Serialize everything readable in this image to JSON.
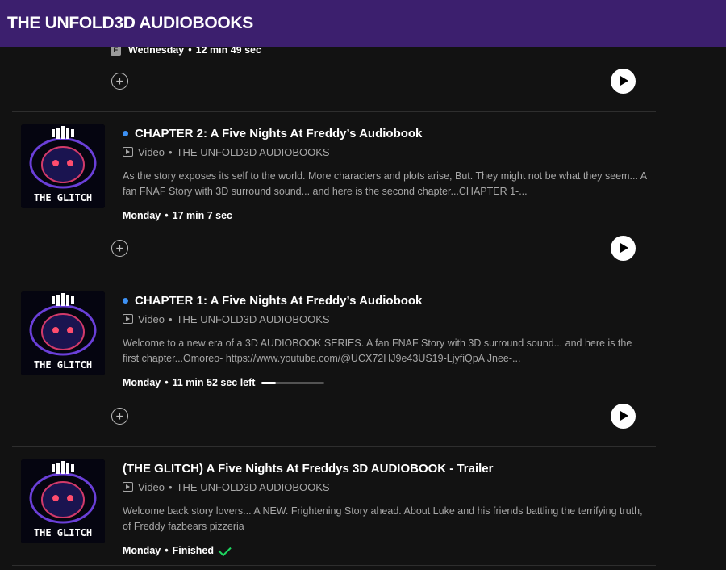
{
  "header": {
    "title": "THE UNFOLD3D AUDIOBOOKS"
  },
  "colors": {
    "header_bg": "#3c1f6e",
    "unplayed_dot": "#3d91f4",
    "finished_check": "#1ed760"
  },
  "partial_episode": {
    "explicit_badge": "E",
    "day": "Wednesday",
    "duration": "12 min 49 sec"
  },
  "episodes": [
    {
      "thumbnail_text": "THE GLITCH",
      "title": "CHAPTER 2: A Five Nights At Freddy’s Audiobook",
      "type": "Video",
      "show": "THE UNFOLD3D AUDIOBOOKS",
      "description": "As the story exposes its self to the world. More characters and plots arise, But. They might not be what they seem... A fan FNAF Story with 3D surround sound... and here is the second chapter...CHAPTER 1-...",
      "day": "Monday",
      "duration": "17 min 7 sec"
    },
    {
      "thumbnail_text": "THE GLITCH",
      "title": "CHAPTER 1: A Five Nights At Freddy’s Audiobook",
      "type": "Video",
      "show": "THE UNFOLD3D AUDIOBOOKS",
      "description": "Welcome to a new era of a 3D AUDIOBOOK SERIES. A fan FNAF Story with 3D surround sound... and here is the first chapter...Omoreo- https://www.youtube.com/@UCX72HJ9e43US19-LjyfiQpA Jnee-...",
      "day": "Monday",
      "duration": "11 min 52 sec left",
      "progress": 0.22
    },
    {
      "thumbnail_text": "THE GLITCH",
      "title": "(THE GLITCH) A Five Nights At Freddys 3D AUDIOBOOK - Trailer",
      "type": "Video",
      "show": "THE UNFOLD3D AUDIOBOOKS",
      "description": "Welcome back story lovers... A NEW. Frightening Story ahead. About Luke and his friends battling the terrifying truth, of Freddy fazbears pizzeria",
      "day": "Monday",
      "duration": "Finished"
    }
  ],
  "bullet": "•",
  "icons": {
    "add": "plus-circle-icon",
    "play": "play-icon",
    "video": "video-icon",
    "finished": "check-icon"
  }
}
